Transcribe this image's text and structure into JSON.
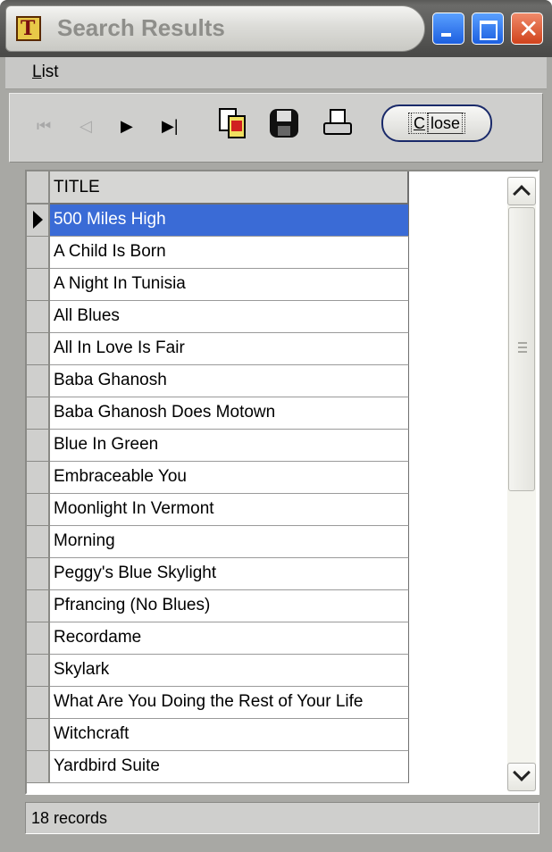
{
  "window": {
    "title": "Search Results",
    "icon": "tunes-app-icon",
    "controls": [
      "minimize",
      "maximize",
      "close"
    ]
  },
  "menu": {
    "items": [
      {
        "label_accel": "L",
        "label_rest": "ist"
      }
    ]
  },
  "toolbar": {
    "nav_first_glyph": "⏮",
    "nav_prev_glyph": "◁",
    "nav_next_glyph": "▶",
    "nav_last_glyph": "▶|",
    "copy_icon": "copy-to-clipboard-icon",
    "save_icon": "floppy-disk-icon",
    "print_icon": "printer-icon",
    "close_accel": "C",
    "close_rest": "lose"
  },
  "grid": {
    "column_header": "TITLE",
    "selected_index": 0,
    "rows": [
      "500 Miles High",
      "A Child Is Born",
      "A Night In Tunisia",
      "All Blues",
      "All In Love Is Fair",
      "Baba Ghanosh",
      "Baba Ghanosh Does Motown",
      "Blue In Green",
      "Embraceable You",
      "Moonlight In Vermont",
      "Morning",
      "Peggy's Blue Skylight",
      "Pfrancing (No Blues)",
      "Recordame",
      "Skylark",
      "What Are You Doing the Rest of Your Life",
      "Witchcraft",
      "Yardbird Suite"
    ]
  },
  "status": {
    "text": "18 records"
  },
  "colors": {
    "selection": "#3a6bd6",
    "titlebar_buttons": "#1c5fe0",
    "close_button": "#d0431c"
  }
}
